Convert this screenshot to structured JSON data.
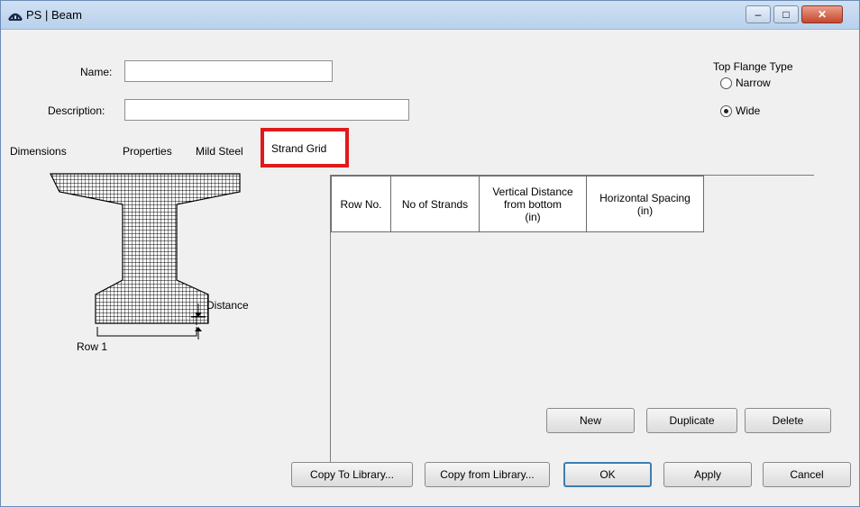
{
  "window": {
    "title": "PS | Beam"
  },
  "titlebar_buttons": {
    "minimize": "–",
    "maximize": "□",
    "close": "✕"
  },
  "form": {
    "name_label": "Name:",
    "name_value": "",
    "description_label": "Description:",
    "description_value": ""
  },
  "top_flange": {
    "title": "Top Flange Type",
    "options": [
      {
        "label": "Narrow",
        "selected": false
      },
      {
        "label": "Wide",
        "selected": true
      }
    ]
  },
  "tabs": [
    {
      "label": "Dimensions",
      "active": false
    },
    {
      "label": "Properties",
      "active": false
    },
    {
      "label": "Mild Steel",
      "active": false
    },
    {
      "label": "Strand Grid",
      "active": true
    }
  ],
  "diagram": {
    "distance_label": "Distance",
    "row_label": "Row 1"
  },
  "table": {
    "columns": [
      {
        "lines": [
          "Row No."
        ]
      },
      {
        "lines": [
          "No of Strands"
        ]
      },
      {
        "lines": [
          "Vertical Distance",
          "from bottom",
          "(in)"
        ]
      },
      {
        "lines": [
          "Horizontal Spacing",
          "(in)"
        ]
      }
    ],
    "rows": []
  },
  "grid_buttons": {
    "new": "New",
    "duplicate": "Duplicate",
    "delete": "Delete"
  },
  "footer_buttons": {
    "copy_to_library": "Copy To Library...",
    "copy_from_library": "Copy from Library...",
    "ok": "OK",
    "apply": "Apply",
    "cancel": "Cancel"
  },
  "colors": {
    "highlight": "#e11a1a",
    "titlebar": "#c4d8ef"
  }
}
